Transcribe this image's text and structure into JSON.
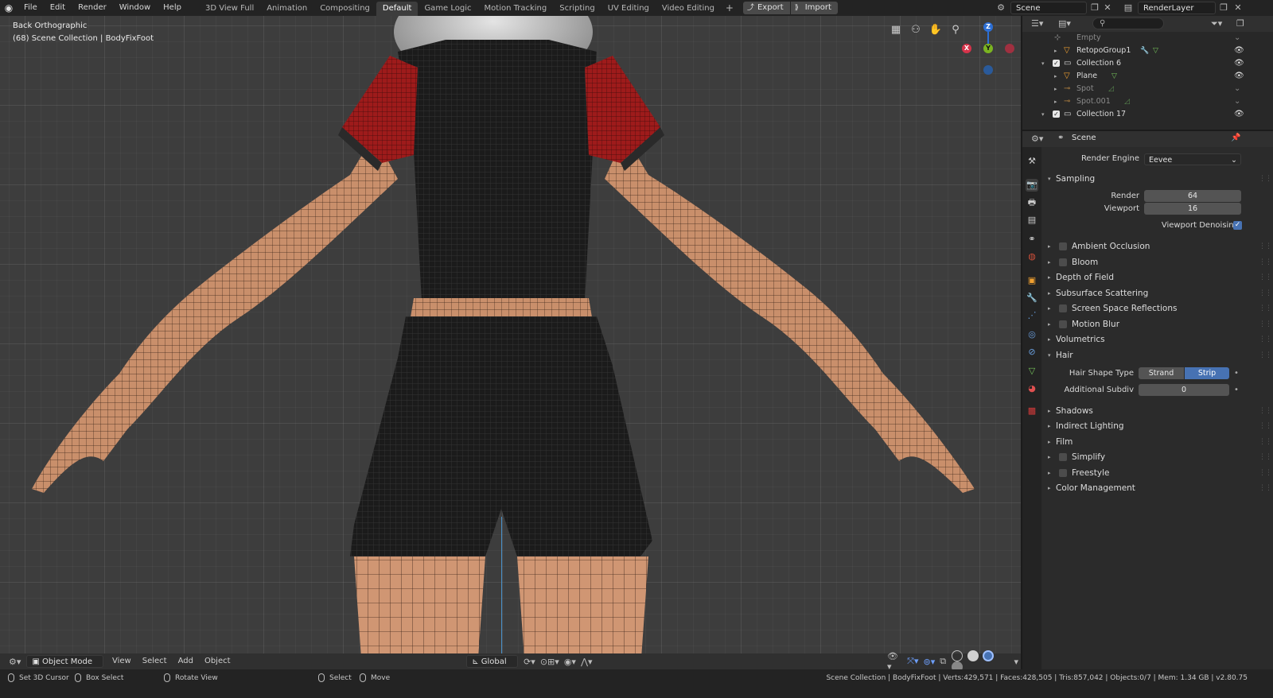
{
  "menu": [
    "File",
    "Edit",
    "Render",
    "Window",
    "Help"
  ],
  "workspaces": [
    "3D View Full",
    "Animation",
    "Compositing",
    "Default",
    "Game Logic",
    "Motion Tracking",
    "Scripting",
    "UV Editing",
    "Video Editing"
  ],
  "active_workspace": "Default",
  "io": {
    "export": "Export",
    "import": "Import"
  },
  "scene_name": "Scene",
  "render_layer": "RenderLayer",
  "viewport": {
    "view_name": "Back Orthographic",
    "collection_info": "(68) Scene Collection | BodyFixFoot",
    "gizmo": {
      "z": "Z",
      "y": "Y",
      "x": "X"
    }
  },
  "viewport_footer": {
    "mode": "Object Mode",
    "menus": [
      "View",
      "Select",
      "Add",
      "Object"
    ],
    "transform_orientation": "Global"
  },
  "statusbar": {
    "left": [
      {
        "action": "Set 3D Cursor"
      },
      {
        "action": "Box Select"
      },
      {
        "action": "Rotate View"
      },
      {
        "action": "Select"
      },
      {
        "action": "Move"
      }
    ],
    "stats": "Scene Collection | BodyFixFoot | Verts:429,571 | Faces:428,505 | Tris:857,042 | Objects:0/7 | Mem: 1.34 GB | v2.80.75"
  },
  "outliner": {
    "rows": [
      {
        "name": "Empty",
        "type": "empty",
        "dim": true
      },
      {
        "name": "RetopoGroup1",
        "type": "mesh",
        "dim": false
      },
      {
        "name": "Collection 6",
        "type": "collection",
        "dim": false
      },
      {
        "name": "Plane",
        "type": "mesh",
        "dim": false
      },
      {
        "name": "Spot",
        "type": "light",
        "dim": true
      },
      {
        "name": "Spot.001",
        "type": "light",
        "dim": true
      },
      {
        "name": "Collection 17",
        "type": "collection",
        "dim": false
      }
    ]
  },
  "properties": {
    "context": "Scene",
    "render_engine_label": "Render Engine",
    "render_engine": "Eevee",
    "sampling": {
      "title": "Sampling",
      "render_label": "Render",
      "render_value": "64",
      "viewport_label": "Viewport",
      "viewport_value": "16",
      "denoise_label": "Viewport Denoising",
      "denoise_checked": true
    },
    "panels_a": [
      {
        "label": "Ambient Occlusion",
        "checkbox": true
      },
      {
        "label": "Bloom",
        "checkbox": true
      },
      {
        "label": "Depth of Field",
        "checkbox": false
      },
      {
        "label": "Subsurface Scattering",
        "checkbox": false
      },
      {
        "label": "Screen Space Reflections",
        "checkbox": true
      },
      {
        "label": "Motion Blur",
        "checkbox": true
      },
      {
        "label": "Volumetrics",
        "checkbox": false
      }
    ],
    "hair": {
      "title": "Hair",
      "shape_label": "Hair Shape Type",
      "shape_options": [
        "Strand",
        "Strip"
      ],
      "shape_selected": "Strip",
      "subdiv_label": "Additional Subdiv",
      "subdiv_value": "0"
    },
    "panels_b": [
      {
        "label": "Shadows",
        "checkbox": false
      },
      {
        "label": "Indirect Lighting",
        "checkbox": false
      },
      {
        "label": "Film",
        "checkbox": false
      },
      {
        "label": "Simplify",
        "checkbox": true
      },
      {
        "label": "Freestyle",
        "checkbox": true
      },
      {
        "label": "Color Management",
        "checkbox": false
      }
    ]
  },
  "colors": {
    "accent": "#4772b3",
    "viewport_bg": "#3d3d3d",
    "skin": "#c98f6b",
    "shirt": "#1a1a1a",
    "sleeve": "#9e1b1b"
  }
}
